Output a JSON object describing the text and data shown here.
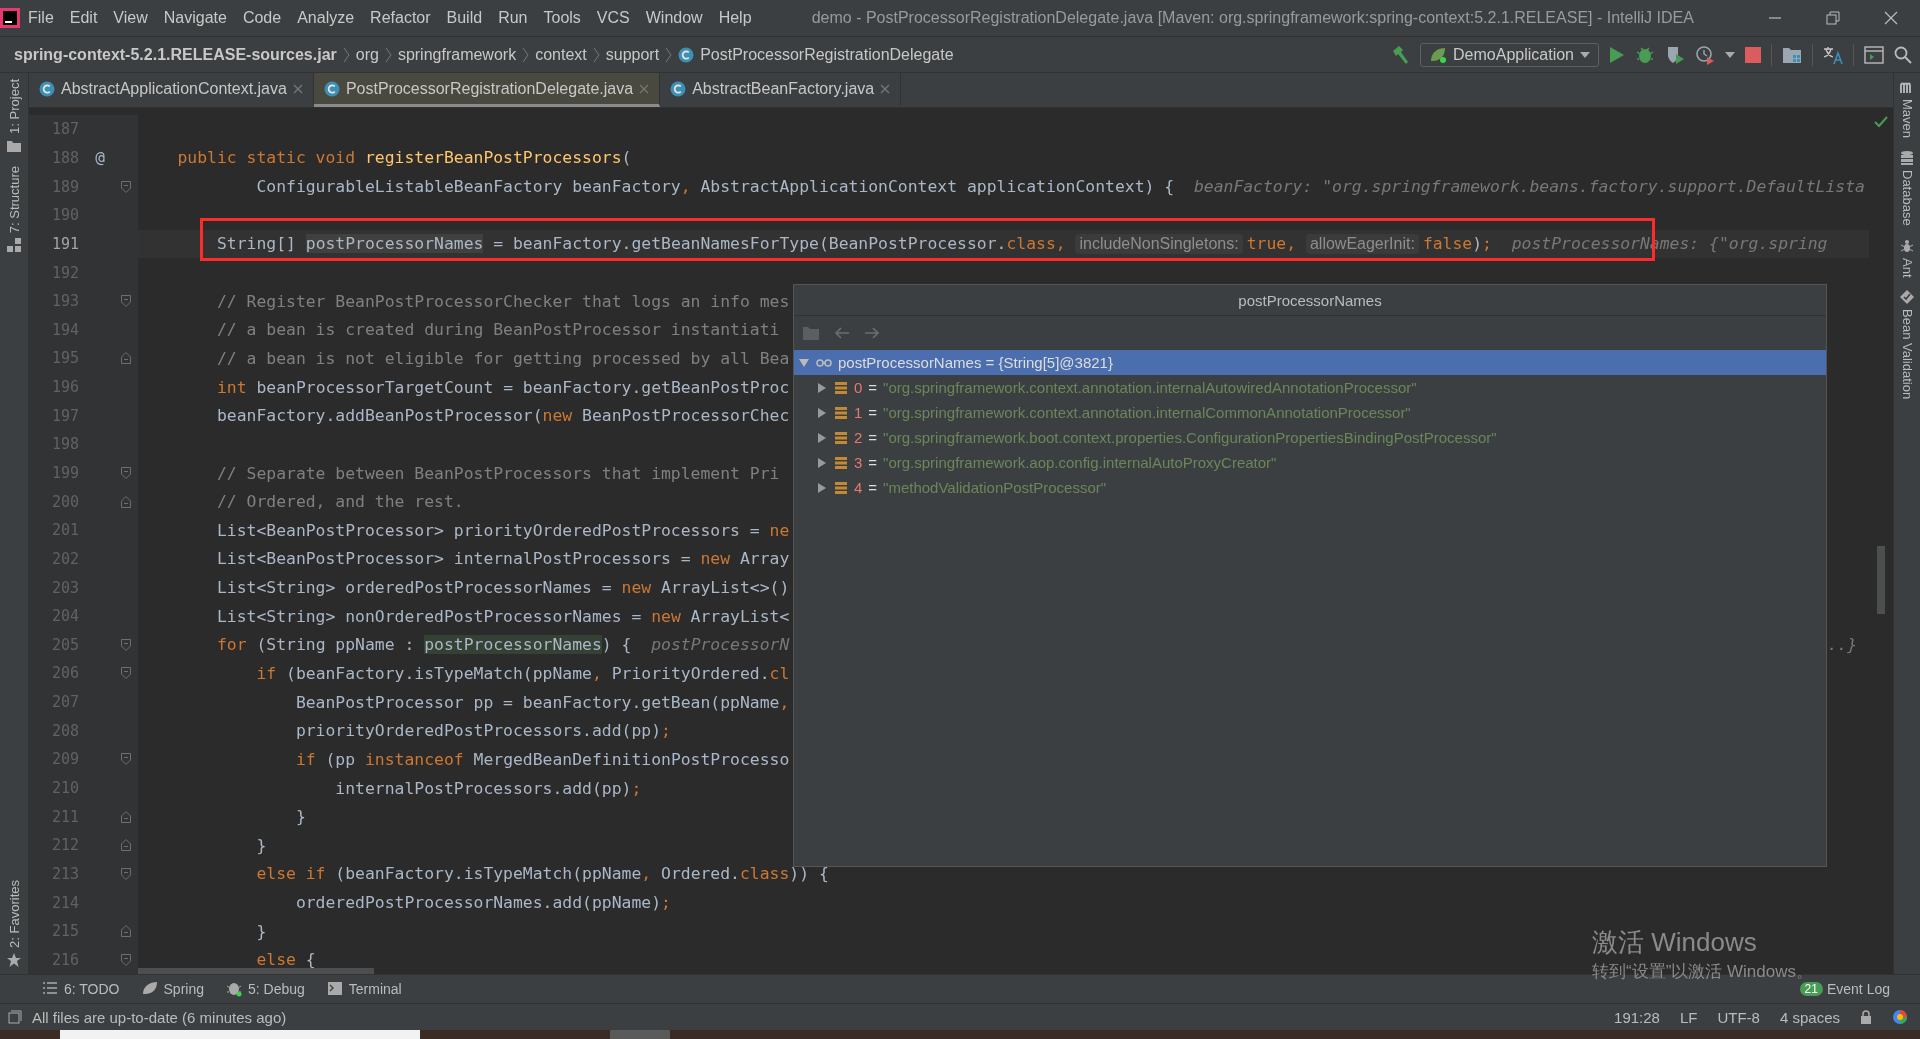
{
  "window": {
    "title": "demo - PostProcessorRegistrationDelegate.java [Maven: org.springframework:spring-context:5.2.1.RELEASE] - IntelliJ IDEA"
  },
  "menu": [
    "File",
    "Edit",
    "View",
    "Navigate",
    "Code",
    "Analyze",
    "Refactor",
    "Build",
    "Run",
    "Tools",
    "VCS",
    "Window",
    "Help"
  ],
  "breadcrumbs": [
    {
      "label": "spring-context-5.2.1.RELEASE-sources.jar",
      "kind": "jar"
    },
    {
      "label": "org",
      "kind": "package"
    },
    {
      "label": "springframework",
      "kind": "package"
    },
    {
      "label": "context",
      "kind": "package"
    },
    {
      "label": "support",
      "kind": "package"
    },
    {
      "label": "PostProcessorRegistrationDelegate",
      "kind": "class"
    }
  ],
  "run_config": {
    "label": "DemoApplication"
  },
  "tabs": [
    {
      "label": "AbstractApplicationContext.java",
      "selected": false
    },
    {
      "label": "PostProcessorRegistrationDelegate.java",
      "selected": true
    },
    {
      "label": "AbstractBeanFactory.java",
      "selected": false
    }
  ],
  "left_stripe": [
    {
      "label": "1: Project",
      "kind": "project"
    },
    {
      "label": "7: Structure",
      "kind": "structure"
    },
    {
      "label": "2: Favorites",
      "kind": "favorites"
    }
  ],
  "right_stripe": [
    {
      "label": "Maven",
      "kind": "maven"
    },
    {
      "label": "Database",
      "kind": "database"
    },
    {
      "label": "Ant",
      "kind": "ant"
    },
    {
      "label": "Bean Validation",
      "kind": "bean"
    }
  ],
  "editor": {
    "lines": [
      {
        "number": "187",
        "current": false
      },
      {
        "number": "188",
        "current": false,
        "mark": "@",
        "tokens": [
          {
            "kind": "keyword",
            "s": "    public static void "
          },
          {
            "kind": "method",
            "s": "registerBeanPostProcessors"
          },
          {
            "kind": "plain",
            "s": "("
          }
        ]
      },
      {
        "number": "189",
        "current": false,
        "fold_start": true,
        "tokens": [
          {
            "kind": "plain",
            "s": "            ConfigurableListableBeanFactory beanFactory"
          },
          {
            "kind": "keyword",
            "s": ", "
          },
          {
            "kind": "plain",
            "s": "AbstractApplicationContext applicationContext) {  "
          },
          {
            "kind": "hint",
            "s": "beanFactory: \"org.springframework.beans.factory.support.DefaultLista"
          }
        ]
      },
      {
        "number": "190",
        "current": false
      },
      {
        "number": "191",
        "current": true,
        "boxed": true,
        "tokens": [
          {
            "kind": "plain",
            "s": "        String[] "
          },
          {
            "kind": "read",
            "s": "postProcessorNames"
          },
          {
            "kind": "plain",
            "s": " = beanFactory.getBeanNamesForType(BeanPostProcessor."
          },
          {
            "kind": "keyword",
            "s": "class, "
          },
          {
            "kind": "param",
            "s": "includeNonSingletons:"
          },
          {
            "kind": "keyword",
            "s": "true, "
          },
          {
            "kind": "param",
            "s": "allowEagerInit:"
          },
          {
            "kind": "keyword",
            "s": "false"
          },
          {
            "kind": "plain",
            "s": ")"
          },
          {
            "kind": "keyword",
            "s": ";  "
          },
          {
            "kind": "hint",
            "s": "postProcessorNames: {\"org.spring"
          }
        ]
      },
      {
        "number": "192",
        "current": false
      },
      {
        "number": "193",
        "current": false,
        "fold_start": true,
        "tokens": [
          {
            "kind": "comment",
            "s": "        // Register BeanPostProcessorChecker that logs an info mes"
          }
        ]
      },
      {
        "number": "194",
        "current": false,
        "tokens": [
          {
            "kind": "comment",
            "s": "        // a bean is created during BeanPostProcessor instantiati"
          }
        ]
      },
      {
        "number": "195",
        "current": false,
        "fold_end": true,
        "tokens": [
          {
            "kind": "comment",
            "s": "        // a bean is not eligible for getting processed by all Bea"
          }
        ]
      },
      {
        "number": "196",
        "current": false,
        "tokens": [
          {
            "kind": "keyword",
            "s": "        int"
          },
          {
            "kind": "plain",
            "s": " beanProcessorTargetCount = beanFactory.getBeanPostProc"
          }
        ]
      },
      {
        "number": "197",
        "current": false,
        "tokens": [
          {
            "kind": "plain",
            "s": "        beanFactory.addBeanPostProcessor("
          },
          {
            "kind": "keyword",
            "s": "new"
          },
          {
            "kind": "plain",
            "s": " BeanPostProcessorChec"
          }
        ]
      },
      {
        "number": "198",
        "current": false
      },
      {
        "number": "199",
        "current": false,
        "fold_start": true,
        "tokens": [
          {
            "kind": "comment",
            "s": "        // Separate between BeanPostProcessors that implement Pri"
          }
        ]
      },
      {
        "number": "200",
        "current": false,
        "fold_end": true,
        "tokens": [
          {
            "kind": "comment",
            "s": "        // Ordered, and the rest."
          }
        ]
      },
      {
        "number": "201",
        "current": false,
        "tokens": [
          {
            "kind": "plain",
            "s": "        List<BeanPostProcessor> priorityOrderedPostProcessors = "
          },
          {
            "kind": "keyword",
            "s": "ne"
          }
        ]
      },
      {
        "number": "202",
        "current": false,
        "tokens": [
          {
            "kind": "plain",
            "s": "        List<BeanPostProcessor> internalPostProcessors = "
          },
          {
            "kind": "keyword",
            "s": "new"
          },
          {
            "kind": "plain",
            "s": " Array"
          }
        ]
      },
      {
        "number": "203",
        "current": false,
        "tokens": [
          {
            "kind": "plain",
            "s": "        List<String> orderedPostProcessorNames = "
          },
          {
            "kind": "keyword",
            "s": "new"
          },
          {
            "kind": "plain",
            "s": " ArrayList<>()"
          }
        ]
      },
      {
        "number": "204",
        "current": false,
        "tokens": [
          {
            "kind": "plain",
            "s": "        List<String> nonOrderedPostProcessorNames = "
          },
          {
            "kind": "keyword",
            "s": "new"
          },
          {
            "kind": "plain",
            "s": " ArrayList<"
          }
        ]
      },
      {
        "number": "205",
        "current": false,
        "fold_start": true,
        "tail": "..}",
        "tokens": [
          {
            "kind": "keyword",
            "s": "        for"
          },
          {
            "kind": "plain",
            "s": " (String ppName : "
          },
          {
            "kind": "usage",
            "s": "postProcessorNames"
          },
          {
            "kind": "plain",
            "s": ") {  "
          },
          {
            "kind": "hint",
            "s": "postProcessorN"
          }
        ]
      },
      {
        "number": "206",
        "current": false,
        "fold_start": true,
        "tokens": [
          {
            "kind": "keyword",
            "s": "            if"
          },
          {
            "kind": "plain",
            "s": " (beanFactory.isTypeMatch(ppName"
          },
          {
            "kind": "keyword",
            "s": ", "
          },
          {
            "kind": "plain",
            "s": "PriorityOrdered."
          },
          {
            "kind": "keyword",
            "s": "cl"
          }
        ]
      },
      {
        "number": "207",
        "current": false,
        "tokens": [
          {
            "kind": "plain",
            "s": "                BeanPostProcessor pp = beanFactory.getBean(ppName"
          },
          {
            "kind": "keyword",
            "s": ","
          }
        ]
      },
      {
        "number": "208",
        "current": false,
        "tokens": [
          {
            "kind": "plain",
            "s": "                priorityOrderedPostProcessors.add(pp)"
          },
          {
            "kind": "keyword",
            "s": ";"
          }
        ]
      },
      {
        "number": "209",
        "current": false,
        "fold_start": true,
        "tokens": [
          {
            "kind": "keyword",
            "s": "                if"
          },
          {
            "kind": "plain",
            "s": " (pp "
          },
          {
            "kind": "keyword",
            "s": "instanceof"
          },
          {
            "kind": "plain",
            "s": " MergedBeanDefinitionPostProcesso"
          }
        ]
      },
      {
        "number": "210",
        "current": false,
        "tokens": [
          {
            "kind": "plain",
            "s": "                    internalPostProcessors.add(pp)"
          },
          {
            "kind": "keyword",
            "s": ";"
          }
        ]
      },
      {
        "number": "211",
        "current": false,
        "fold_end": true,
        "tokens": [
          {
            "kind": "plain",
            "s": "                }"
          }
        ]
      },
      {
        "number": "212",
        "current": false,
        "fold_end": true,
        "tokens": [
          {
            "kind": "plain",
            "s": "            }"
          }
        ]
      },
      {
        "number": "213",
        "current": false,
        "fold_start": true,
        "tokens": [
          {
            "kind": "keyword",
            "s": "            else if"
          },
          {
            "kind": "plain",
            "s": " (beanFactory.isTypeMatch(ppName"
          },
          {
            "kind": "keyword",
            "s": ", "
          },
          {
            "kind": "plain",
            "s": "Ordered."
          },
          {
            "kind": "keyword",
            "s": "class"
          },
          {
            "kind": "plain",
            "s": ")) {"
          }
        ]
      },
      {
        "number": "214",
        "current": false,
        "tokens": [
          {
            "kind": "plain",
            "s": "                orderedPostProcessorNames.add(ppName)"
          },
          {
            "kind": "keyword",
            "s": ";"
          }
        ]
      },
      {
        "number": "215",
        "current": false,
        "fold_end": true,
        "tokens": [
          {
            "kind": "plain",
            "s": "            }"
          }
        ]
      },
      {
        "number": "216",
        "current": false,
        "fold_start": true,
        "tokens": [
          {
            "kind": "keyword",
            "s": "            else"
          },
          {
            "kind": "plain",
            "s": " {"
          }
        ]
      }
    ]
  },
  "debug_popup": {
    "title": "postProcessorNames",
    "tree": {
      "label": "postProcessorNames = {String[5]@3821}",
      "expanded": true,
      "selected": true,
      "children": [
        {
          "index": "0",
          "operator": "=",
          "value": "\"org.springframework.context.annotation.internalAutowiredAnnotationProcessor\"",
          "expanded": false,
          "selected": false
        },
        {
          "index": "1",
          "operator": "=",
          "value": "\"org.springframework.context.annotation.internalCommonAnnotationProcessor\"",
          "expanded": false,
          "selected": false
        },
        {
          "index": "2",
          "operator": "=",
          "value": "\"org.springframework.boot.context.properties.ConfigurationPropertiesBindingPostProcessor\"",
          "expanded": false,
          "selected": false
        },
        {
          "index": "3",
          "operator": "=",
          "value": "\"org.springframework.aop.config.internalAutoProxyCreator\"",
          "expanded": false,
          "selected": false
        },
        {
          "index": "4",
          "operator": "=",
          "value": "\"methodValidationPostProcessor\"",
          "expanded": false,
          "selected": false
        }
      ]
    }
  },
  "tool_tabs": [
    {
      "label": "6: TODO",
      "kind": "todo"
    },
    {
      "label": "Spring",
      "kind": "spring"
    },
    {
      "label": "5: Debug",
      "kind": "debug"
    },
    {
      "label": "Terminal",
      "kind": "terminal"
    }
  ],
  "event_log": {
    "badge": "21",
    "label": "Event Log"
  },
  "status_bar": {
    "message": "All files are up-to-date (6 minutes ago)",
    "position": "191:28",
    "line_separator": "LF",
    "encoding": "UTF-8",
    "indent": "4 spaces"
  },
  "os_notice": {
    "title": "激活 Windows",
    "message": "转到“设置”以激活 Windows。"
  }
}
